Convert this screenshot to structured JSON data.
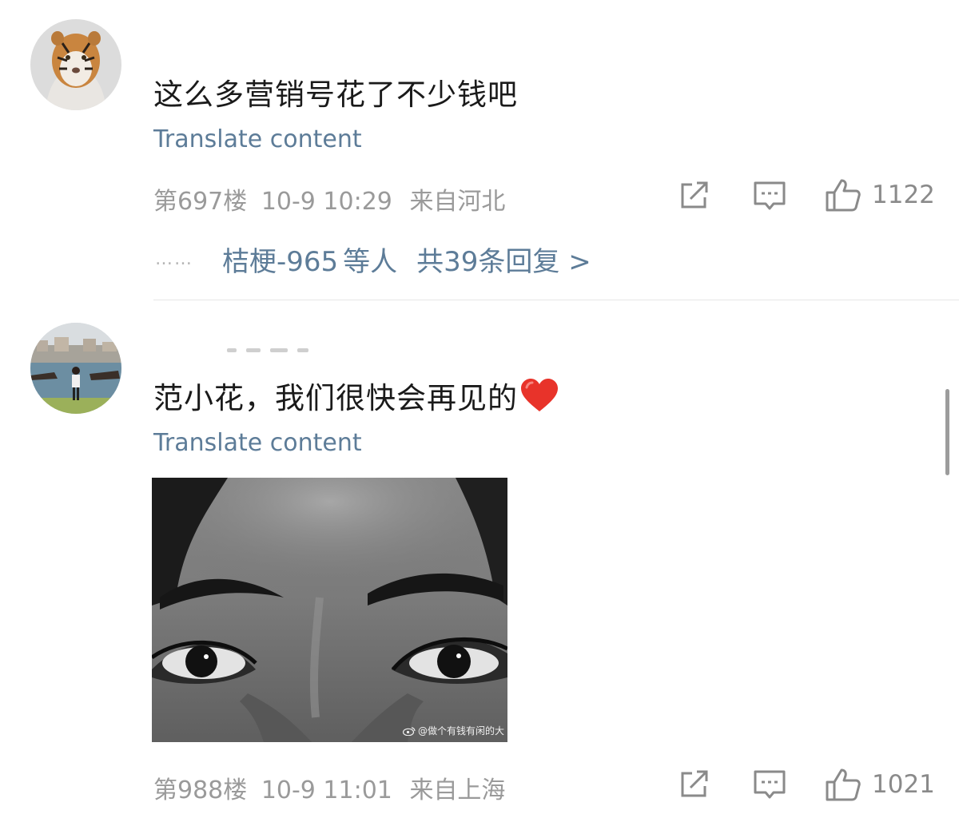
{
  "comments": [
    {
      "text": "这么多营销号花了不少钱吧",
      "translate_label": "Translate content",
      "floor": "第697楼",
      "time": "10-9 10:29",
      "location": "来自河北",
      "likes": "1122",
      "replies": {
        "dots": "……",
        "user": "桔梗-965",
        "suffix": "等人",
        "total": "共39条回复 >"
      }
    },
    {
      "text": "范小花，我们很快会再见的",
      "translate_label": "Translate content",
      "floor": "第988楼",
      "time": "10-9 11:01",
      "location": "来自上海",
      "likes": "1021",
      "image_watermark": "@做个有钱有闲的大"
    }
  ],
  "icons": {
    "share": "share-icon",
    "comment": "comment-icon",
    "like": "thumbs-up-icon",
    "heart": "heart-icon",
    "weibo": "weibo-icon"
  },
  "colors": {
    "link": "#5d7c98",
    "meta": "#9a9a9a",
    "text": "#1a1a1a",
    "heart": "#e8332a"
  }
}
